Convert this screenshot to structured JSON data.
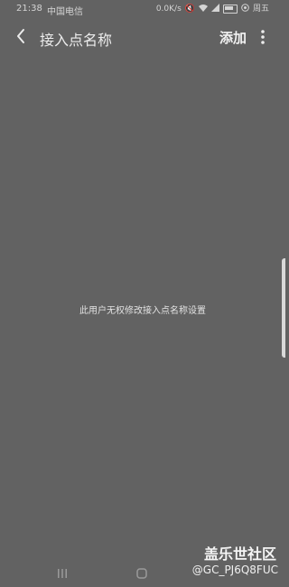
{
  "status_bar": {
    "time": "21:38",
    "carrier": "中国电信",
    "network_speed": "0.0K/s",
    "day": "周五",
    "icons": [
      "mute-icon",
      "wifi-icon",
      "signal-icon",
      "battery-icon",
      "location-icon"
    ]
  },
  "app_bar": {
    "title": "接入点名称",
    "add_label": "添加",
    "icons": [
      "back-icon",
      "more-icon"
    ]
  },
  "main": {
    "message": "此用户无权修改接入点名称设置"
  },
  "watermark": {
    "title": "盖乐世社区",
    "user": "@GC_PJ6Q8FUC"
  },
  "nav": {
    "icons": [
      "recent-apps-icon",
      "home-icon"
    ]
  },
  "colors": {
    "background": "#626262",
    "text": "#e8e8e8"
  }
}
